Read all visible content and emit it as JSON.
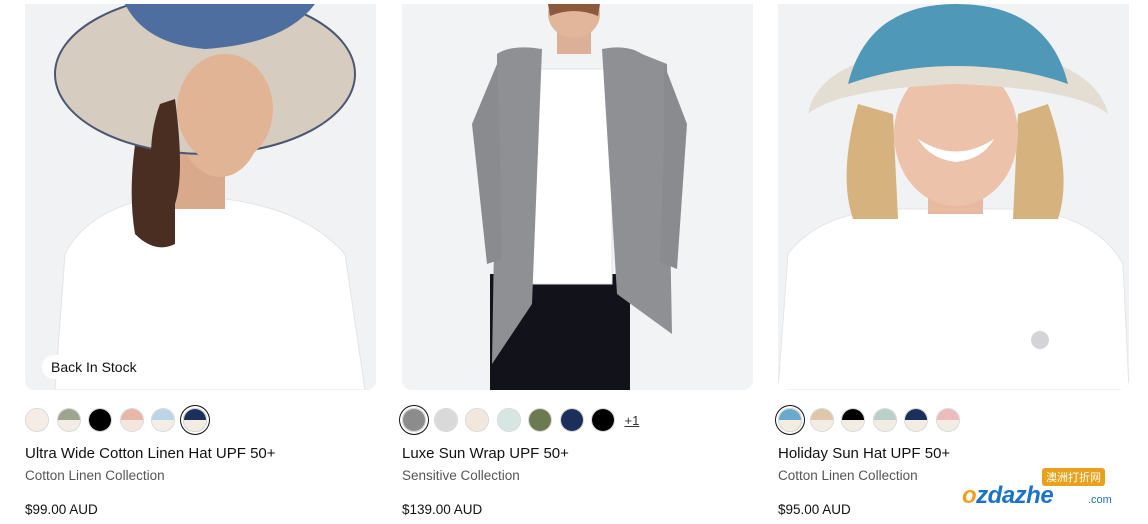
{
  "products": [
    {
      "badge": "Back In Stock",
      "swatches": [
        {
          "top": "#f6ece6",
          "bottom": "#f6ece6",
          "selected": false
        },
        {
          "top": "#9ea48e",
          "bottom": "#f1ece4",
          "selected": false
        },
        {
          "top": "#000000",
          "bottom": "#000000",
          "selected": false
        },
        {
          "top": "#e7b8a9",
          "bottom": "#f3e6de",
          "selected": false
        },
        {
          "top": "#bcd4ea",
          "bottom": "#f3ede6",
          "selected": false
        },
        {
          "top": "#1c2f5a",
          "bottom": "#f4ece1",
          "selected": true
        }
      ],
      "more": "",
      "title": "Ultra Wide Cotton Linen Hat UPF 50+",
      "collection": "Cotton Linen Collection",
      "price": "$99.00 AUD"
    },
    {
      "badge": "",
      "swatches": [
        {
          "top": "#8c8c8c",
          "bottom": "#8c8c8c",
          "selected": true
        },
        {
          "top": "#d9d9d9",
          "bottom": "#d9d9d9",
          "selected": false
        },
        {
          "top": "#f1e7dd",
          "bottom": "#f1e7dd",
          "selected": false
        },
        {
          "top": "#d6e6e2",
          "bottom": "#d6e6e2",
          "selected": false
        },
        {
          "top": "#6c7a4f",
          "bottom": "#6c7a4f",
          "selected": false
        },
        {
          "top": "#1c2f5a",
          "bottom": "#1c2f5a",
          "selected": false
        },
        {
          "top": "#000000",
          "bottom": "#000000",
          "selected": false
        }
      ],
      "more": "+1",
      "title": "Luxe Sun Wrap UPF 50+",
      "collection": "Sensitive Collection",
      "price": "$139.00 AUD"
    },
    {
      "badge": "",
      "swatches": [
        {
          "top": "#6aa8cc",
          "bottom": "#f3ece2",
          "selected": true
        },
        {
          "top": "#dcc7ab",
          "bottom": "#f3ece2",
          "selected": false
        },
        {
          "top": "#000000",
          "bottom": "#f3ece2",
          "selected": false
        },
        {
          "top": "#b9cfca",
          "bottom": "#f3ece2",
          "selected": false
        },
        {
          "top": "#1c2f5a",
          "bottom": "#f3ece2",
          "selected": false
        },
        {
          "top": "#ebbcb9",
          "bottom": "#f3ece2",
          "selected": false
        }
      ],
      "more": "",
      "title": "Holiday Sun Hat UPF 50+",
      "collection": "Cotton Linen Collection",
      "price": "$95.00 AUD"
    }
  ],
  "watermark": {
    "cn": "澳洲打折网",
    "logo_prefix": "o",
    "logo_rest": "zdazhe",
    "com": ".com"
  }
}
